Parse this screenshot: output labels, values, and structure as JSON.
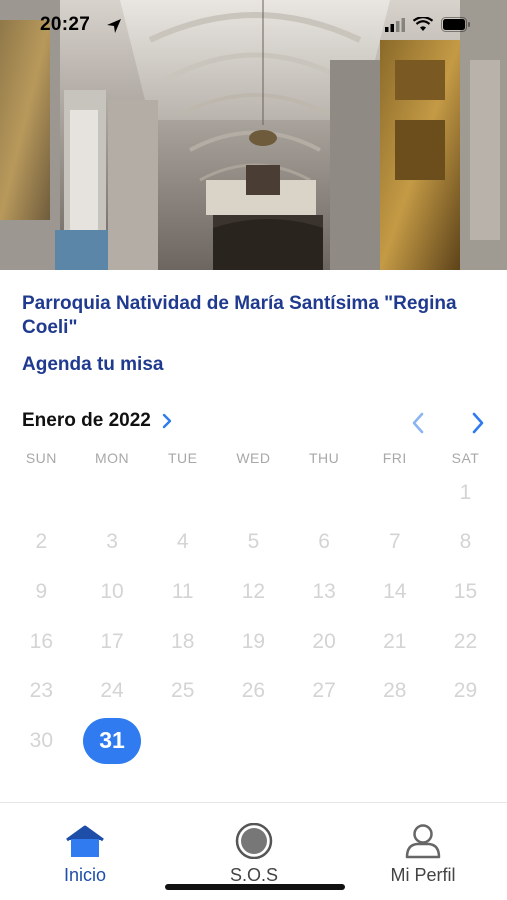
{
  "status_bar": {
    "time": "20:27"
  },
  "hero": {
    "image_name": "church-interior"
  },
  "parish": {
    "title": "Parroquia Natividad de María Santísima \"Regina Coeli\"",
    "agenda_link": "Agenda tu misa"
  },
  "calendar": {
    "month_label": "Enero de 2022",
    "weekdays": [
      "SUN",
      "MON",
      "TUE",
      "WED",
      "THU",
      "FRI",
      "SAT"
    ],
    "leading_blanks": 6,
    "days": [
      "1",
      "2",
      "3",
      "4",
      "5",
      "6",
      "7",
      "8",
      "9",
      "10",
      "11",
      "12",
      "13",
      "14",
      "15",
      "16",
      "17",
      "18",
      "19",
      "20",
      "21",
      "22",
      "23",
      "24",
      "25",
      "26",
      "27",
      "28",
      "29",
      "30",
      "31"
    ],
    "selected_day": "31",
    "accent_color": "#2f7bef"
  },
  "tab_bar": {
    "tabs": [
      {
        "label": "Inicio",
        "icon": "home-icon",
        "active": true
      },
      {
        "label": "S.O.S",
        "icon": "sos-icon",
        "active": false
      },
      {
        "label": "Mi Perfil",
        "icon": "profile-icon",
        "active": false
      }
    ]
  },
  "colors": {
    "brand": "#1f3a8f",
    "tab_active": "#1f4ea8"
  }
}
